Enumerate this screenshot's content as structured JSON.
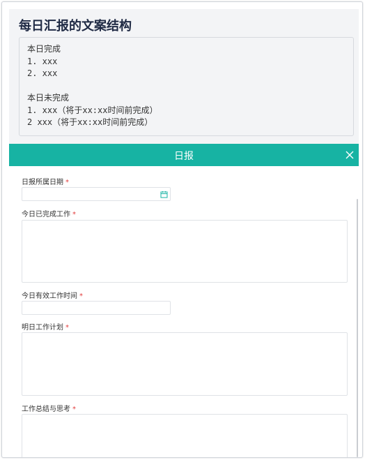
{
  "top": {
    "title": "每日汇报的文案结构",
    "code_lines": [
      "本日完成",
      "1. xxx",
      "2. xxx",
      "",
      "本日未完成",
      "1. xxx（将于xx:xx时间前完成）",
      "2 xxx（将于xx:xx时间前完成）"
    ]
  },
  "modal": {
    "title": "日报",
    "accent_color": "#17b3a3",
    "fields": [
      {
        "label": "日报所属日期",
        "required": "*",
        "value": ""
      },
      {
        "label": "今日已完成工作",
        "required": "*",
        "value": ""
      },
      {
        "label": "今日有效工作时间",
        "required": "*",
        "value": ""
      },
      {
        "label": "明日工作计划",
        "required": "*",
        "value": ""
      },
      {
        "label": "工作总结与思考",
        "required": "*",
        "value": ""
      }
    ]
  },
  "icons": {
    "close": "close-icon",
    "calendar": "calendar-icon"
  }
}
